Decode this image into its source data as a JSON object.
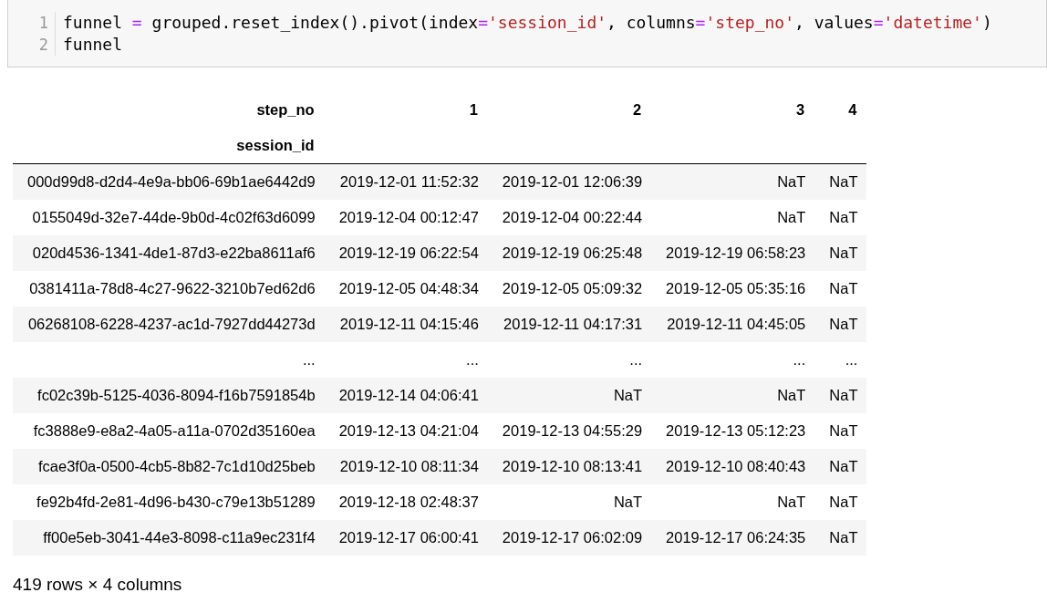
{
  "code_cell": {
    "lines": [
      {
        "number": "1",
        "tokens": [
          {
            "kind": "plain",
            "text": "funnel "
          },
          {
            "kind": "operator",
            "text": "="
          },
          {
            "kind": "plain",
            "text": " grouped.reset_index().pivot(index"
          },
          {
            "kind": "operator",
            "text": "="
          },
          {
            "kind": "string",
            "text": "'session_id'"
          },
          {
            "kind": "plain",
            "text": ", columns"
          },
          {
            "kind": "operator",
            "text": "="
          },
          {
            "kind": "string",
            "text": "'step_no'"
          },
          {
            "kind": "plain",
            "text": ", values"
          },
          {
            "kind": "operator",
            "text": "="
          },
          {
            "kind": "string",
            "text": "'datetime'"
          },
          {
            "kind": "plain",
            "text": ")"
          }
        ]
      },
      {
        "number": "2",
        "tokens": [
          {
            "kind": "plain",
            "text": "funnel"
          }
        ]
      }
    ]
  },
  "table": {
    "columns": [
      "step_no",
      "1",
      "2",
      "3",
      "4"
    ],
    "index_name": "session_id",
    "rows": [
      [
        "000d99d8-d2d4-4e9a-bb06-69b1ae6442d9",
        "2019-12-01 11:52:32",
        "2019-12-01 12:06:39",
        "NaT",
        "NaT"
      ],
      [
        "0155049d-32e7-44de-9b0d-4c02f63d6099",
        "2019-12-04 00:12:47",
        "2019-12-04 00:22:44",
        "NaT",
        "NaT"
      ],
      [
        "020d4536-1341-4de1-87d3-e22ba8611af6",
        "2019-12-19 06:22:54",
        "2019-12-19 06:25:48",
        "2019-12-19 06:58:23",
        "NaT"
      ],
      [
        "0381411a-78d8-4c27-9622-3210b7ed62d6",
        "2019-12-05 04:48:34",
        "2019-12-05 05:09:32",
        "2019-12-05 05:35:16",
        "NaT"
      ],
      [
        "06268108-6228-4237-ac1d-7927dd44273d",
        "2019-12-11 04:15:46",
        "2019-12-11 04:17:31",
        "2019-12-11 04:45:05",
        "NaT"
      ],
      [
        "...",
        "...",
        "...",
        "...",
        "..."
      ],
      [
        "fc02c39b-5125-4036-8094-f16b7591854b",
        "2019-12-14 04:06:41",
        "NaT",
        "NaT",
        "NaT"
      ],
      [
        "fc3888e9-e8a2-4a05-a11a-0702d35160ea",
        "2019-12-13 04:21:04",
        "2019-12-13 04:55:29",
        "2019-12-13 05:12:23",
        "NaT"
      ],
      [
        "fcae3f0a-0500-4cb5-8b82-7c1d10d25beb",
        "2019-12-10 08:11:34",
        "2019-12-10 08:13:41",
        "2019-12-10 08:40:43",
        "NaT"
      ],
      [
        "fe92b4fd-2e81-4d96-b430-c79e13b51289",
        "2019-12-18 02:48:37",
        "NaT",
        "NaT",
        "NaT"
      ],
      [
        "ff00e5eb-3041-44e3-8098-c11a9ec231f4",
        "2019-12-17 06:00:41",
        "2019-12-17 06:02:09",
        "2019-12-17 06:24:35",
        "NaT"
      ]
    ]
  },
  "summary": "419 rows × 4 columns"
}
